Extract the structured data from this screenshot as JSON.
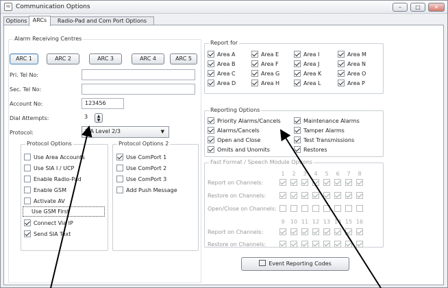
{
  "window": {
    "title": "Communication Options",
    "controls": [
      "–",
      "□",
      "✕"
    ]
  },
  "tabs": [
    "Options",
    "ARCs",
    "Radio-Pad and Com Port Options"
  ],
  "arc": {
    "group_title": "Alarm Receiving Centres",
    "buttons": [
      "ARC 1",
      "ARC 2",
      "ARC 3",
      "ARC 4",
      "ARC 5"
    ],
    "pri_tel_label": "Pri. Tel No:",
    "pri_tel_value": "",
    "sec_tel_label": "Sec. Tel No:",
    "sec_tel_value": "",
    "account_label": "Account No:",
    "account_value": "123456",
    "dial_label": "Dial Attempts:",
    "dial_value": "3",
    "protocol_label": "Protocol:",
    "protocol_value": "SIA Level 2/3"
  },
  "protocol_options": {
    "title": "Protocol Options",
    "items": [
      {
        "label": "Use Area Accounts",
        "checked": false
      },
      {
        "label": "Use SIA I / UCP",
        "checked": false
      },
      {
        "label": "Enable Radio-Pad",
        "checked": false
      },
      {
        "label": "Enable GSM",
        "checked": false
      },
      {
        "label": "Activate AV",
        "checked": false
      },
      {
        "label": "Use GSM First",
        "checked": false
      },
      {
        "label": "Connect Via IP",
        "checked": true
      },
      {
        "label": "Send SIA Text",
        "checked": true
      }
    ]
  },
  "protocol_options_2": {
    "title": "Protocol Options 2",
    "items": [
      {
        "label": "Use ComPort 1",
        "checked": true
      },
      {
        "label": "Use ComPort 2",
        "checked": false
      },
      {
        "label": "Use ComPort 3",
        "checked": false
      },
      {
        "label": "Add Push Message",
        "checked": false
      }
    ]
  },
  "report_for": {
    "title": "Report for",
    "areas": [
      "Area A",
      "Area E",
      "Area I",
      "Area M",
      "Area B",
      "Area F",
      "Area J",
      "Area N",
      "Area C",
      "Area G",
      "Area K",
      "Area O",
      "Area D",
      "Area H",
      "Area L",
      "Area P"
    ]
  },
  "reporting_options": {
    "title": "Reporting Options",
    "items": [
      "Priority Alarms/Cancels",
      "Maintenance Alarms",
      "Alarms/Cancels",
      "Tamper Alarms",
      "Open and Close",
      "Test Transmissions",
      "Omits and Unomits",
      "Restores"
    ]
  },
  "fast_format": {
    "title": "Fast Format / Speech Module Options",
    "channels_1": [
      "1",
      "2",
      "3",
      "4",
      "5",
      "6",
      "7",
      "8"
    ],
    "channels_2": [
      "9",
      "10",
      "11",
      "12",
      "13",
      "14",
      "15",
      "16"
    ],
    "report_label": "Report on Channels:",
    "restore_label": "Restore on Channels:",
    "openclose_label": "Open/Close on Channels:"
  },
  "event_button": "Event Reporting Codes"
}
